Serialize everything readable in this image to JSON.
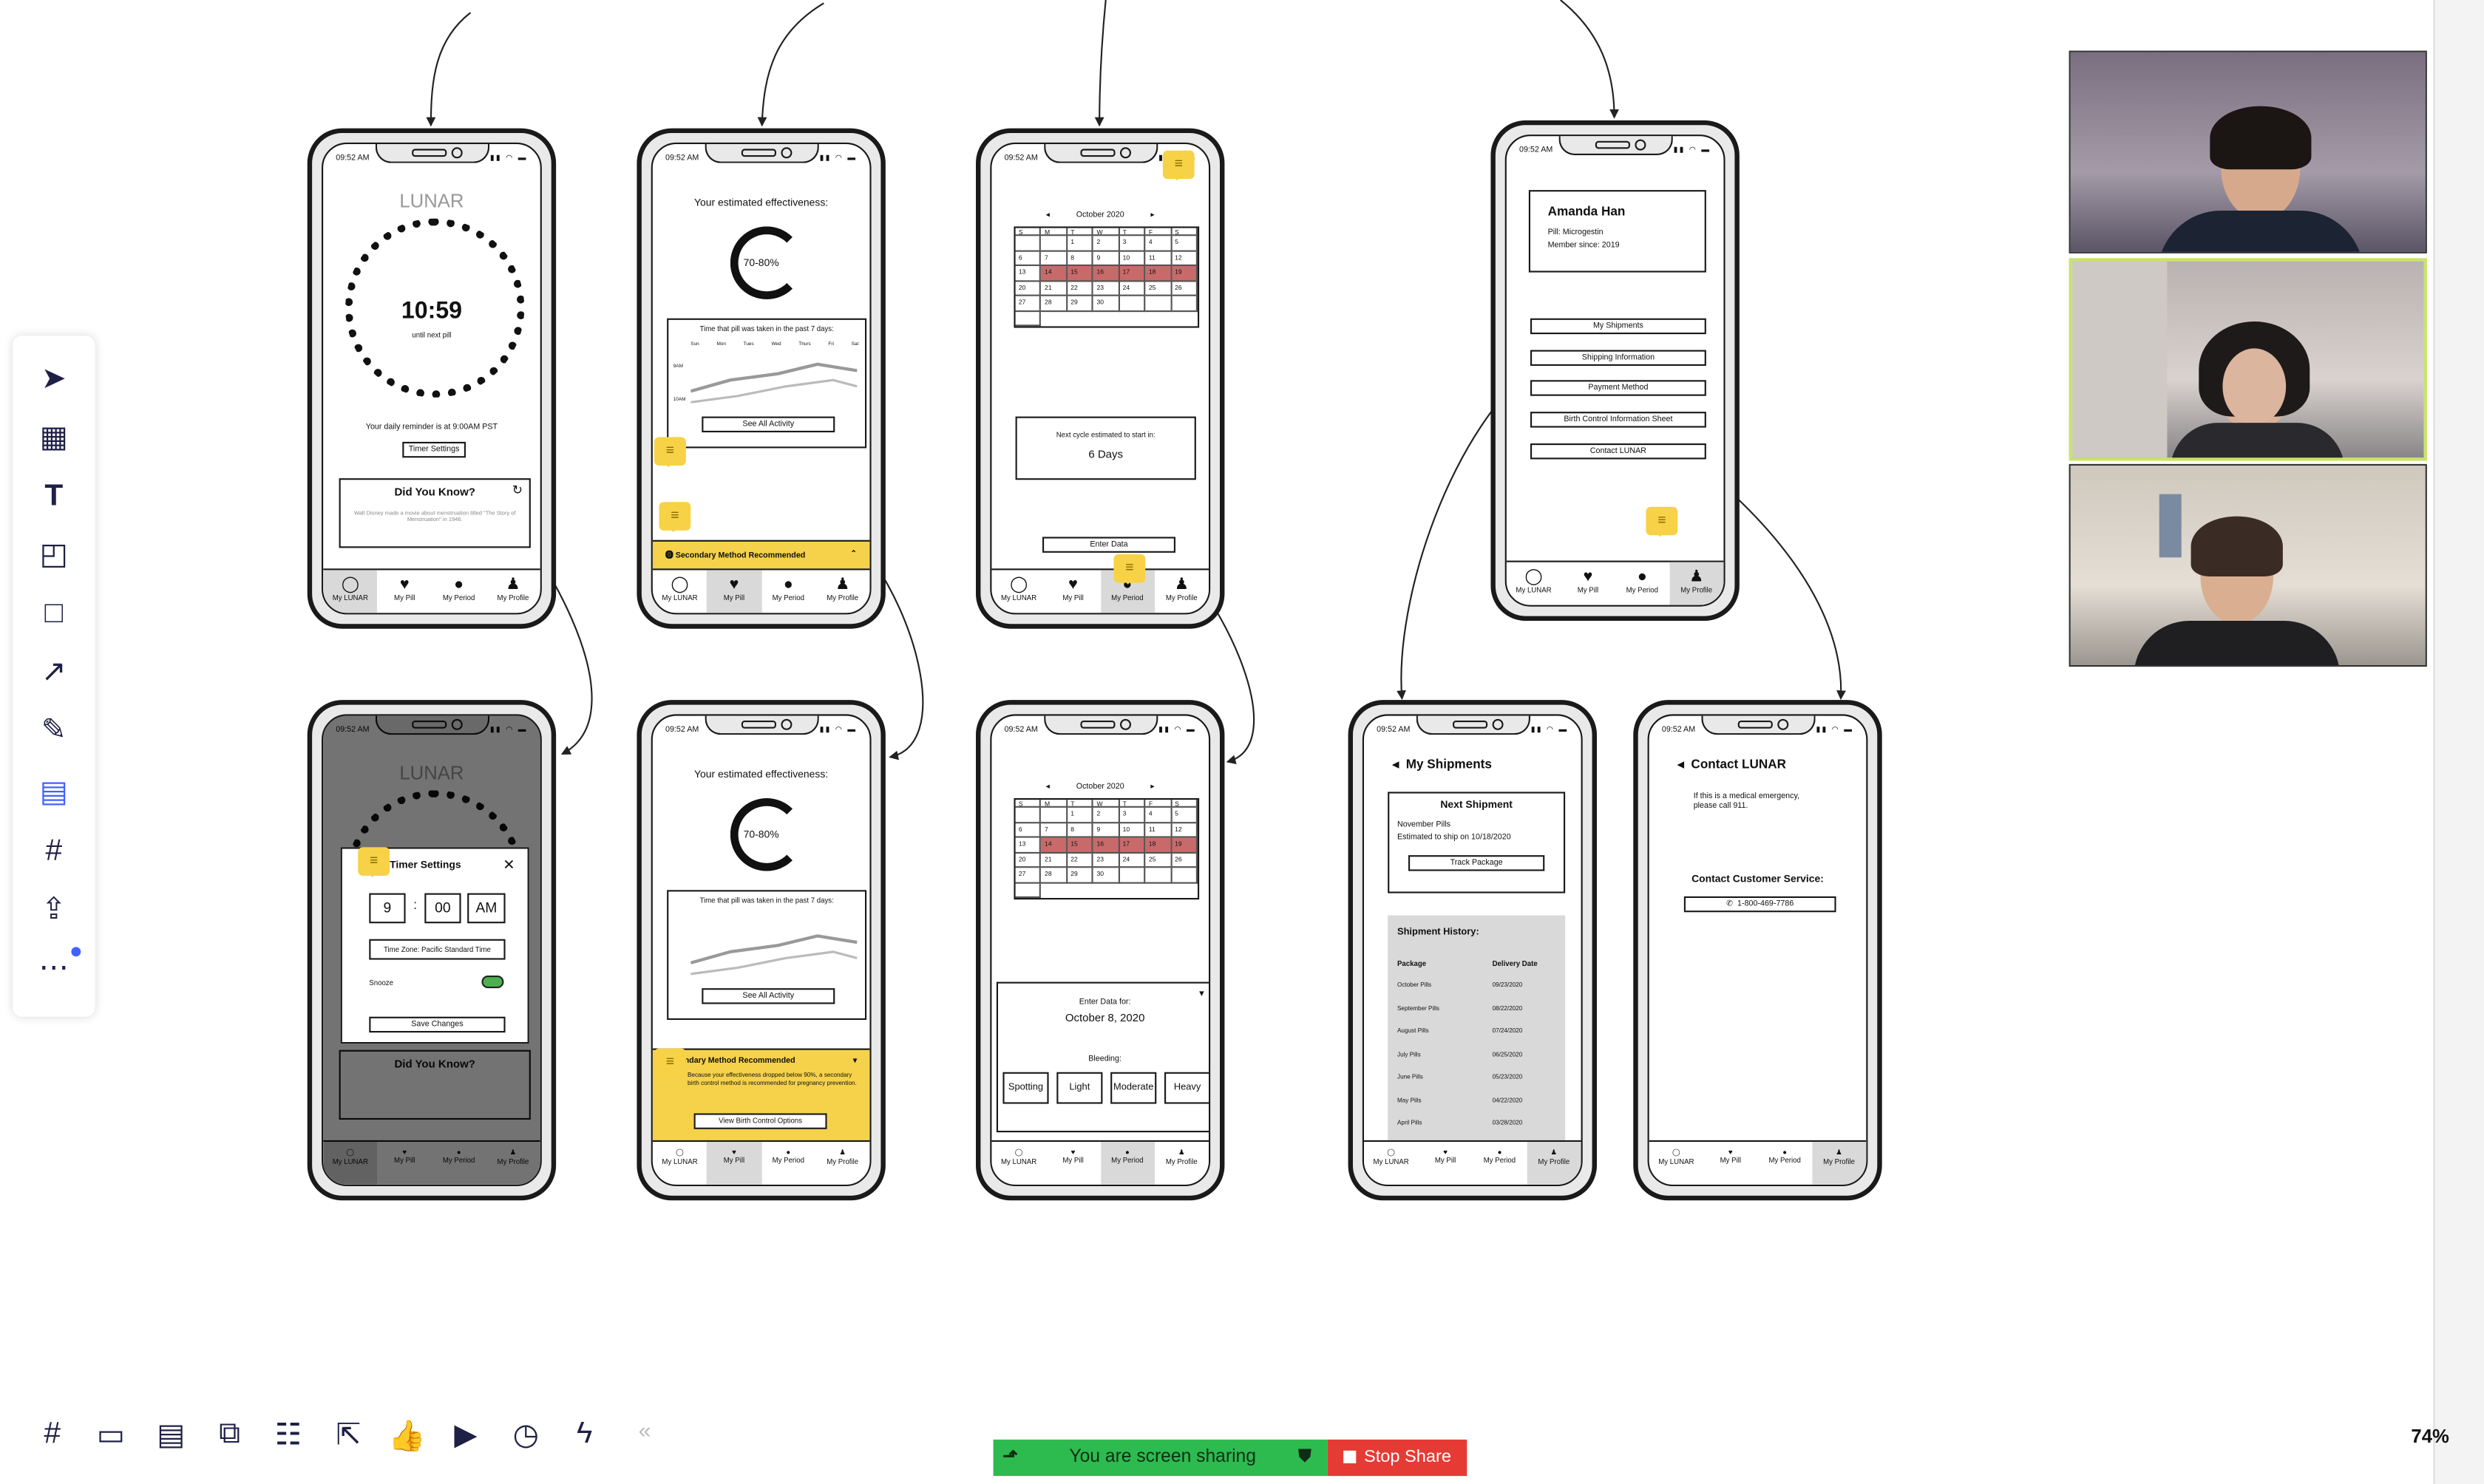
{
  "zoom": "74%",
  "share_bar": {
    "status": "You are screen sharing",
    "stop_label": "Stop Share"
  },
  "nav": {
    "lunar": "My LUNAR",
    "pill": "My Pill",
    "period": "My Period",
    "profile": "My Profile"
  },
  "status_time": "09:52 AM",
  "p1": {
    "logo": "LUNAR",
    "countdown": "10:59",
    "countdown_sub": "until next pill",
    "reminder": "Your daily reminder is at 9:00AM PST",
    "timer_btn": "Timer Settings",
    "dyk_title": "Did You Know?",
    "dyk_body": "Walt Disney made a movie about menstruation titled \"The Story of Menstruation\" in 1946."
  },
  "p2": {
    "title": "Your estimated effectiveness:",
    "pct": "70-80%",
    "chart_title": "Time that pill was taken in the past 7 days:",
    "days": [
      "Sun",
      "Mon",
      "Tues",
      "Wed",
      "Thurs",
      "Fri",
      "Sat"
    ],
    "y1": "9AM",
    "y2": "10AM",
    "see_all": "See All Activity",
    "banner": "Secondary Method Recommended",
    "banner_body": "Because your effectiveness dropped below 90%, a secondary birth control method is recommended for pregnancy prevention.",
    "options_btn": "View Birth Control Options"
  },
  "p3": {
    "month": "October 2020",
    "weekdays": [
      "S",
      "M",
      "T",
      "W",
      "T",
      "F",
      "S"
    ],
    "dates": [
      "",
      "",
      "1",
      "2",
      "3",
      "4",
      "5",
      "6",
      "7",
      "8",
      "9",
      "10",
      "11",
      "12",
      "13",
      "14",
      "15",
      "16",
      "17",
      "18",
      "19",
      "20",
      "21",
      "22",
      "23",
      "24",
      "25",
      "26",
      "27",
      "28",
      "29",
      "30",
      "",
      "",
      "",
      ""
    ],
    "next_cycle": "Next cycle estimated to start in:",
    "days_left": "6 Days",
    "enter_btn": "Enter Data",
    "enter_for": "Enter Data for:",
    "enter_date": "October 8, 2020",
    "bleeding": "Bleeding:",
    "flow": [
      "Spotting",
      "Light",
      "Moderate",
      "Heavy"
    ]
  },
  "p4": {
    "name": "Amanda Han",
    "pill": "Pill: Microgestin",
    "member": "Member since: 2019",
    "menu": [
      "My Shipments",
      "Shipping Information",
      "Payment Method",
      "Birth Control Information Sheet",
      "Contact LUNAR"
    ]
  },
  "p5": {
    "title": "Timer Settings",
    "hour": "9",
    "minute": "00",
    "ampm": "AM",
    "tz": "Time Zone: Pacific Standard Time",
    "snooze": "Snooze",
    "save": "Save Changes"
  },
  "p8": {
    "title": "My Shipments",
    "next": "Next Shipment",
    "pills": "November Pills",
    "est": "Estimated to ship on 10/18/2020",
    "track": "Track Package",
    "history": "Shipment History:",
    "h_pkg": "Package",
    "h_date": "Delivery Date",
    "rows": [
      [
        "October Pills",
        "09/23/2020"
      ],
      [
        "September Pills",
        "08/22/2020"
      ],
      [
        "August Pills",
        "07/24/2020"
      ],
      [
        "July Pills",
        "06/25/2020"
      ],
      [
        "June Pills",
        "05/23/2020"
      ],
      [
        "May Pills",
        "04/22/2020"
      ],
      [
        "April Pills",
        "03/28/2020"
      ]
    ]
  },
  "p9": {
    "title": "Contact LUNAR",
    "emergency": "If this is a medical emergency, please call 911.",
    "cs": "Contact Customer Service:",
    "phone": "1-800-469-7786"
  },
  "accent": {
    "yellow": "#f5d24a",
    "red": "#c96a6a",
    "share_green": "#2dbb4f",
    "stop_red": "#e63b35"
  }
}
